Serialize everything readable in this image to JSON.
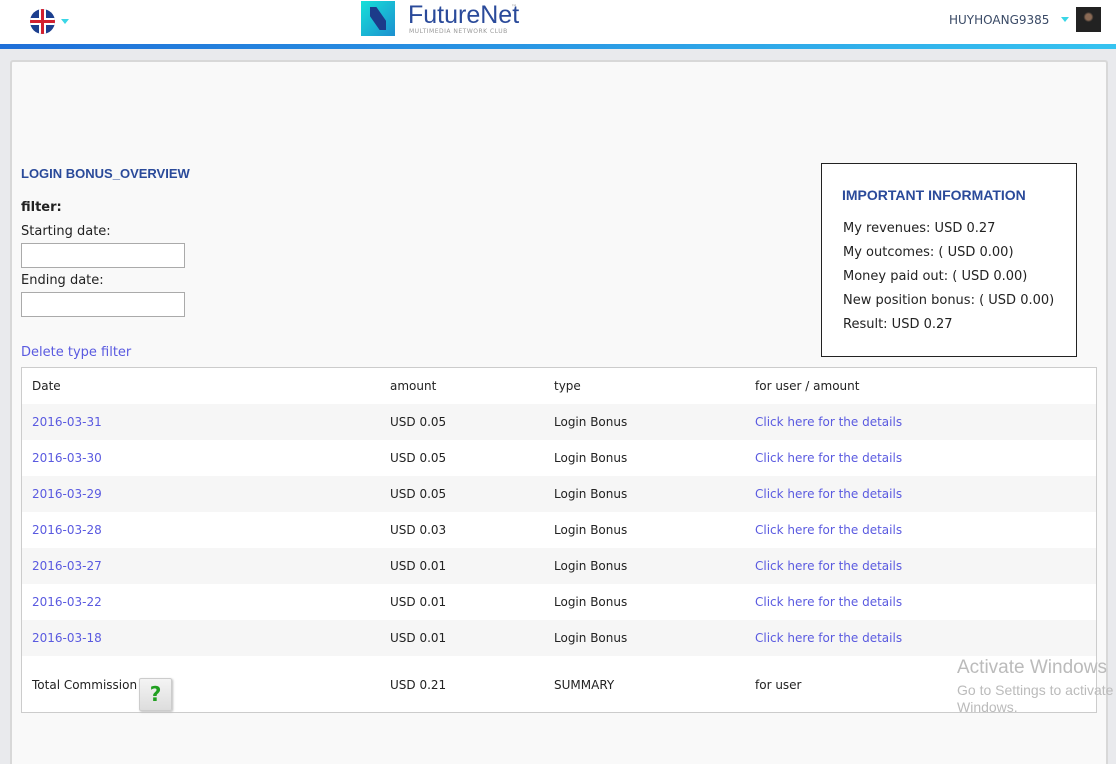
{
  "header": {
    "brand": "FutureNet",
    "brand_tm": "™",
    "brand_tagline": "MULTIMEDIA NETWORK CLUB",
    "username": "HUYHOANG9385",
    "language": "English"
  },
  "page": {
    "title": "LOGIN BONUS_OVERVIEW",
    "filter_label": "filter:",
    "start_label": "Starting date:",
    "start_value": "",
    "end_label": "Ending date:",
    "end_value": "",
    "delete_filter": "Delete type filter"
  },
  "info": {
    "title": "IMPORTANT INFORMATION",
    "lines": [
      "My revenues: USD 0.27",
      "My outcomes: ( USD 0.00)",
      "Money paid out: ( USD 0.00)",
      "New position bonus: ( USD 0.00)",
      "Result: USD 0.27"
    ]
  },
  "table": {
    "headers": [
      "Date",
      "amount",
      "type",
      "for user / amount"
    ],
    "rows": [
      {
        "date": "2016-03-31",
        "amount": "USD 0.05",
        "type": "Login Bonus",
        "link": "Click here for the details"
      },
      {
        "date": "2016-03-30",
        "amount": "USD 0.05",
        "type": "Login Bonus",
        "link": "Click here for the details"
      },
      {
        "date": "2016-03-29",
        "amount": "USD 0.05",
        "type": "Login Bonus",
        "link": "Click here for the details"
      },
      {
        "date": "2016-03-28",
        "amount": "USD 0.03",
        "type": "Login Bonus",
        "link": "Click here for the details"
      },
      {
        "date": "2016-03-27",
        "amount": "USD 0.01",
        "type": "Login Bonus",
        "link": "Click here for the details"
      },
      {
        "date": "2016-03-22",
        "amount": "USD 0.01",
        "type": "Login Bonus",
        "link": "Click here for the details"
      },
      {
        "date": "2016-03-18",
        "amount": "USD 0.01",
        "type": "Login Bonus",
        "link": "Click here for the details"
      }
    ],
    "total": {
      "label": "Total Commission",
      "help": "?",
      "amount": "USD 0.21",
      "type": "SUMMARY",
      "user": "for user"
    }
  },
  "watermark": {
    "line1": "Activate Windows",
    "line2": "Go to Settings to activate Windows."
  }
}
